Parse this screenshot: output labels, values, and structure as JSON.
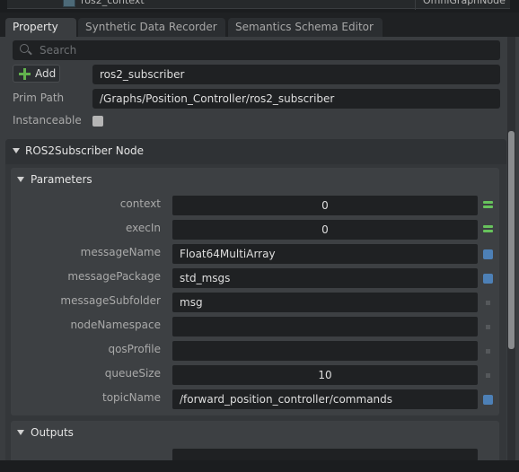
{
  "stage_row": {
    "name": "ros2_context",
    "type": "OmniGraphNode"
  },
  "tabs": [
    {
      "label": "Property",
      "active": true
    },
    {
      "label": "Synthetic Data Recorder",
      "active": false
    },
    {
      "label": "Semantics Schema Editor",
      "active": false
    }
  ],
  "search": {
    "placeholder": "Search"
  },
  "add_button": {
    "label": "Add",
    "icon": "plus-icon"
  },
  "prim": {
    "name_value": "ros2_subscriber",
    "path_label": "Prim Path",
    "path_value": "/Graphs/Position_Controller/ros2_subscriber",
    "instanceable_label": "Instanceable",
    "instanceable_checked": false
  },
  "node_section": {
    "title": "ROS2Subscriber Node"
  },
  "parameters": {
    "title": "Parameters",
    "rows": [
      {
        "label": "context",
        "value": "0",
        "numeric": true,
        "indicator": "exec"
      },
      {
        "label": "execIn",
        "value": "0",
        "numeric": true,
        "indicator": "exec"
      },
      {
        "label": "messageName",
        "value": "Float64MultiArray",
        "numeric": false,
        "indicator": "blue"
      },
      {
        "label": "messagePackage",
        "value": "std_msgs",
        "numeric": false,
        "indicator": "blue"
      },
      {
        "label": "messageSubfolder",
        "value": "msg",
        "numeric": false,
        "indicator": "dot"
      },
      {
        "label": "nodeNamespace",
        "value": "",
        "numeric": false,
        "indicator": "dot"
      },
      {
        "label": "qosProfile",
        "value": "",
        "numeric": false,
        "indicator": "dot"
      },
      {
        "label": "queueSize",
        "value": "10",
        "numeric": true,
        "indicator": "dot"
      },
      {
        "label": "topicName",
        "value": "/forward_position_controller/commands",
        "numeric": false,
        "indicator": "blue"
      }
    ]
  },
  "outputs": {
    "title": "Outputs"
  },
  "colors": {
    "exec_indicator": "#67c25c",
    "connected_indicator": "#4d80b6",
    "add_icon": "#62b24d"
  }
}
